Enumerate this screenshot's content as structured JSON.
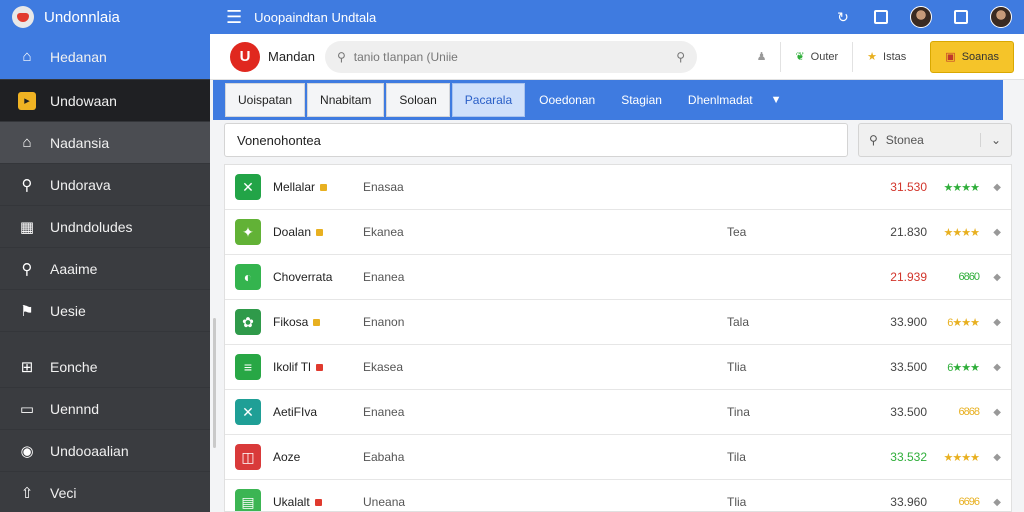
{
  "sidebar": {
    "title": "Undonnlaia",
    "items": [
      {
        "label": "Hedanan",
        "icon": "home-icon",
        "glyph": "⌂"
      },
      {
        "label": "Undowaan",
        "icon": "dashboard-icon",
        "glyph": "▸"
      },
      {
        "label": "Nadansia",
        "icon": "home-icon",
        "glyph": "⌂"
      },
      {
        "label": "Undorava",
        "icon": "search-icon",
        "glyph": "⚲"
      },
      {
        "label": "Undndoludes",
        "icon": "grid-icon",
        "glyph": "▦"
      },
      {
        "label": "Aaaime",
        "icon": "magnifier-icon",
        "glyph": "⚲"
      },
      {
        "label": "Uesie",
        "icon": "flag-icon",
        "glyph": "⚑"
      },
      {
        "label": "Eonche",
        "icon": "bag-icon",
        "glyph": "⊞"
      },
      {
        "label": "Uennnd",
        "icon": "card-icon",
        "glyph": "▭"
      },
      {
        "label": "Undooaalian",
        "icon": "gauge-icon",
        "glyph": "◉"
      },
      {
        "label": "Veci",
        "icon": "upload-icon",
        "glyph": "⇧"
      }
    ]
  },
  "topbar": {
    "title": "Uoopaindtan Undtala"
  },
  "header": {
    "brand_letter": "U",
    "brand_name": "Mandan",
    "search_placeholder": "tanio tIanpan (Uniie",
    "btn_user": "",
    "btn_outer": "Outer",
    "btn_istas": "Istas",
    "btn_soanas": "Soanas"
  },
  "tabs": [
    {
      "label": "Uoispatan",
      "style": "white"
    },
    {
      "label": "Nnabitam",
      "style": "white"
    },
    {
      "label": "Soloan",
      "style": "white"
    },
    {
      "label": "Pacarala",
      "style": "selected"
    },
    {
      "label": "Ooedonan",
      "style": "plain"
    },
    {
      "label": "Stagian",
      "style": "plain"
    },
    {
      "label": "Dhenlmadat",
      "style": "plain"
    }
  ],
  "filter": {
    "value": "Vonenohontea",
    "sort_label": "Stonea"
  },
  "rows": [
    {
      "name": "Mellalar",
      "badge": "#e8b020",
      "category": "Enasaa",
      "tag": "",
      "price": "31.530",
      "price_color": "#d2352b",
      "stars": "★★★★",
      "stars_color": "#2fae3a",
      "icon_bg": "#22a447",
      "icon_glyph": "✕"
    },
    {
      "name": "Doalan",
      "badge": "#e8b020",
      "category": "Ekanea",
      "tag": "Tea",
      "price": "21.830",
      "price_color": "#444",
      "stars": "★★★★",
      "stars_color": "#e8b020",
      "icon_bg": "#62b236",
      "icon_glyph": "✦"
    },
    {
      "name": "Choverrata",
      "badge": "",
      "category": "Enanea",
      "tag": "",
      "price": "21.939",
      "price_color": "#d2352b",
      "stars": "6860",
      "stars_color": "#2fae3a",
      "icon_bg": "#34b44e",
      "icon_glyph": "◐"
    },
    {
      "name": "Fikosa",
      "badge": "#e8b020",
      "category": "Enanon",
      "tag": "Tala",
      "price": "33.900",
      "price_color": "#444",
      "stars": "6★★★",
      "stars_color": "#e8b020",
      "icon_bg": "#2f9a4a",
      "icon_glyph": "✿"
    },
    {
      "name": "Ikolif Tl",
      "badge": "#e03a2e",
      "category": "Ekasea",
      "tag": "Tlia",
      "price": "33.500",
      "price_color": "#444",
      "stars": "6★★★",
      "stars_color": "#2fae3a",
      "icon_bg": "#28a745",
      "icon_glyph": "≡"
    },
    {
      "name": "AetiFIva",
      "badge": "",
      "category": "Enanea",
      "tag": "Tina",
      "price": "33.500",
      "price_color": "#444",
      "stars": "6868",
      "stars_color": "#e8b020",
      "icon_bg": "#1f9f96",
      "icon_glyph": "✕"
    },
    {
      "name": "Aoze",
      "badge": "",
      "category": "Eabaha",
      "tag": "Tila",
      "price": "33.532",
      "price_color": "#2fae3a",
      "stars": "★★★★",
      "stars_color": "#e8b020",
      "icon_bg": "#d93a3a",
      "icon_glyph": "◫"
    },
    {
      "name": "Ukalalt",
      "badge": "#e03a2e",
      "category": "Uneana",
      "tag": "Tlia",
      "price": "33.960",
      "price_color": "#444",
      "stars": "6696",
      "stars_color": "#e8b020",
      "icon_bg": "#3cb553",
      "icon_glyph": "▤"
    }
  ],
  "colors": {
    "primary": "#3f7be0",
    "sidebar_bg": "#3a3c40",
    "accent_yellow": "#f5c429",
    "brand_red": "#e0281f"
  }
}
